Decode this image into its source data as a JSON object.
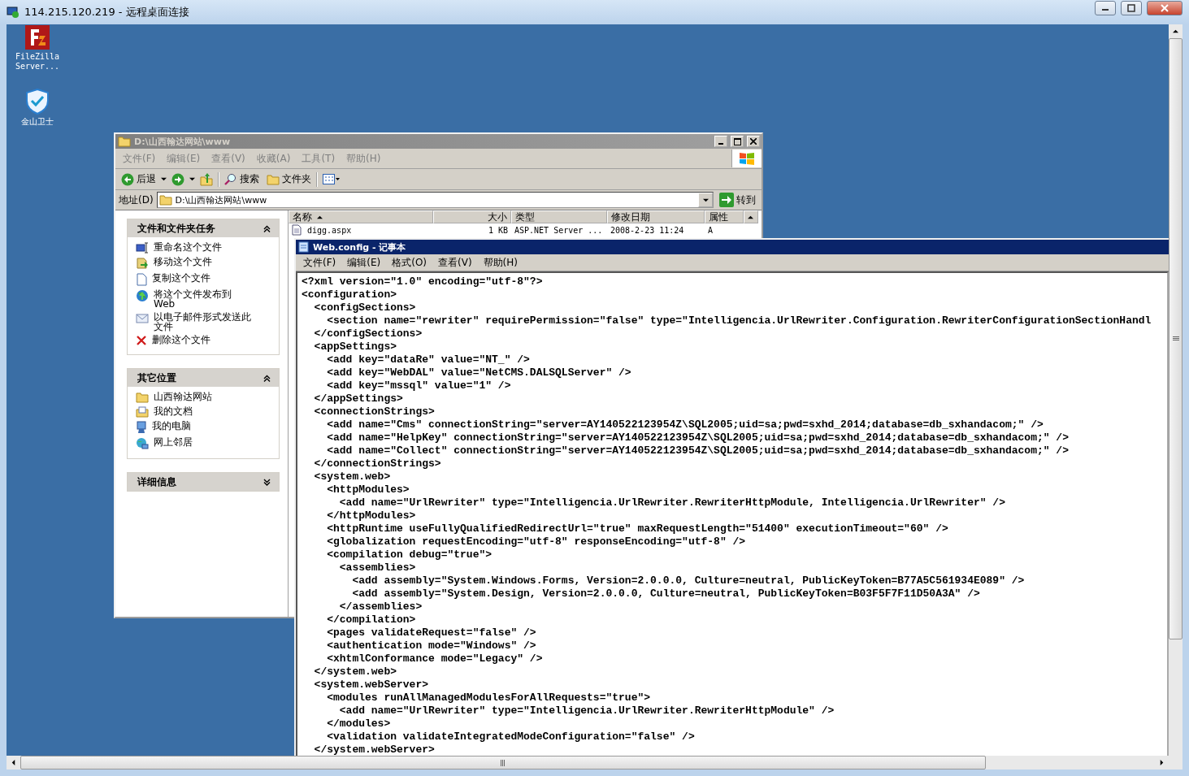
{
  "rdp_window": {
    "title": "114.215.120.219 - 远程桌面连接"
  },
  "desktop_icons": [
    {
      "label": "FileZilla Server..."
    },
    {
      "label": "金山卫士"
    }
  ],
  "explorer": {
    "title": "D:\\山西翰达网站\\www",
    "active": false,
    "menu": [
      "文件(F)",
      "编辑(E)",
      "查看(V)",
      "收藏(A)",
      "工具(T)",
      "帮助(H)"
    ],
    "toolbar": {
      "back": "后退",
      "search": "搜索",
      "folders": "文件夹"
    },
    "address": {
      "label": "地址(D)",
      "value": "D:\\山西翰达网站\\www",
      "go": "转到"
    },
    "task_panels": [
      {
        "title": "文件和文件夹任务",
        "expanded": true,
        "items": [
          "重命名这个文件",
          "移动这个文件",
          "复制这个文件",
          "将这个文件发布到 Web",
          "以电子邮件形式发送此文件",
          "删除这个文件"
        ]
      },
      {
        "title": "其它位置",
        "expanded": true,
        "items": [
          "山西翰达网站",
          "我的文档",
          "我的电脑",
          "网上邻居"
        ]
      },
      {
        "title": "详细信息",
        "expanded": false
      }
    ],
    "file_list": {
      "columns": [
        "名称",
        "大小",
        "类型",
        "修改日期",
        "属性"
      ],
      "rows": [
        [
          "digg.aspx",
          "1 KB",
          "ASP.NET Server ...",
          "2008-2-23 11:24",
          "A"
        ]
      ]
    }
  },
  "notepad": {
    "title": "Web.config - 记事本",
    "active": true,
    "menu": [
      "文件(F)",
      "编辑(E)",
      "格式(O)",
      "查看(V)",
      "帮助(H)"
    ],
    "lines": [
      "<?xml version=\"1.0\" encoding=\"utf-8\"?>",
      "<configuration>",
      "  <configSections>",
      "    <section name=\"rewriter\" requirePermission=\"false\" type=\"Intelligencia.UrlRewriter.Configuration.RewriterConfigurationSectionHandl",
      "  </configSections>",
      "  <appSettings>",
      "    <add key=\"dataRe\" value=\"NT_\" />",
      "    <add key=\"WebDAL\" value=\"NetCMS.DALSQLServer\" />",
      "    <add key=\"mssql\" value=\"1\" />",
      "  </appSettings>",
      "  <connectionStrings>",
      "    <add name=\"Cms\" connectionString=\"server=AY140522123954Z\\SQL2005;uid=sa;pwd=sxhd_2014;database=db_sxhandacom;\" />",
      "    <add name=\"HelpKey\" connectionString=\"server=AY140522123954Z\\SQL2005;uid=sa;pwd=sxhd_2014;database=db_sxhandacom;\" />",
      "    <add name=\"Collect\" connectionString=\"server=AY140522123954Z\\SQL2005;uid=sa;pwd=sxhd_2014;database=db_sxhandacom;\" />",
      "  </connectionStrings>",
      "  <system.web>",
      "    <httpModules>",
      "      <add name=\"UrlRewriter\" type=\"Intelligencia.UrlRewriter.RewriterHttpModule, Intelligencia.UrlRewriter\" />",
      "    </httpModules>",
      "    <httpRuntime useFullyQualifiedRedirectUrl=\"true\" maxRequestLength=\"51400\" executionTimeout=\"60\" />",
      "    <globalization requestEncoding=\"utf-8\" responseEncoding=\"utf-8\" />",
      "    <compilation debug=\"true\">",
      "      <assemblies>",
      "        <add assembly=\"System.Windows.Forms, Version=2.0.0.0, Culture=neutral, PublicKeyToken=B77A5C561934E089\" />",
      "        <add assembly=\"System.Design, Version=2.0.0.0, Culture=neutral, PublicKeyToken=B03F5F7F11D50A3A\" />",
      "      </assemblies>",
      "    </compilation>",
      "    <pages validateRequest=\"false\" />",
      "    <authentication mode=\"Windows\" />",
      "    <xhtmlConformance mode=\"Legacy\" />",
      "  </system.web>",
      "  <system.webServer>",
      "    <modules runAllManagedModulesForAllRequests=\"true\">",
      "      <add name=\"UrlRewriter\" type=\"Intelligencia.UrlRewriter.RewriterHttpModule\" />",
      "    </modules>",
      "    <validation validateIntegratedModeConfiguration=\"false\" />",
      "  </system.webServer>"
    ]
  }
}
